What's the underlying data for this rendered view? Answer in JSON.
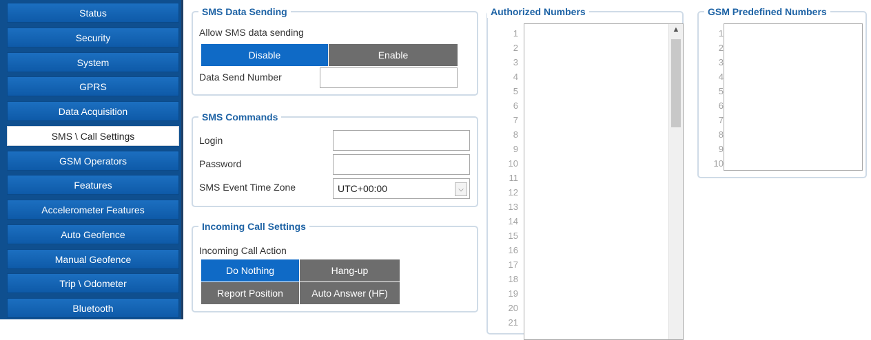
{
  "sidebar": {
    "items": [
      {
        "label": "Status",
        "active": false
      },
      {
        "label": "Security",
        "active": false
      },
      {
        "label": "System",
        "active": false
      },
      {
        "label": "GPRS",
        "active": false
      },
      {
        "label": "Data Acquisition",
        "active": false
      },
      {
        "label": "SMS \\ Call Settings",
        "active": true
      },
      {
        "label": "GSM Operators",
        "active": false
      },
      {
        "label": "Features",
        "active": false
      },
      {
        "label": "Accelerometer Features",
        "active": false
      },
      {
        "label": "Auto Geofence",
        "active": false
      },
      {
        "label": "Manual Geofence",
        "active": false
      },
      {
        "label": "Trip \\ Odometer",
        "active": false
      },
      {
        "label": "Bluetooth",
        "active": false
      }
    ]
  },
  "sms_data_sending": {
    "title": "SMS Data Sending",
    "allow_label": "Allow SMS data sending",
    "options": [
      "Disable",
      "Enable"
    ],
    "selected": "Disable",
    "number_label": "Data Send Number",
    "number_value": ""
  },
  "sms_commands": {
    "title": "SMS Commands",
    "login_label": "Login",
    "login_value": "",
    "password_label": "Password",
    "password_value": "",
    "timezone_label": "SMS Event Time Zone",
    "timezone_value": "UTC+00:00"
  },
  "incoming_call": {
    "title": "Incoming Call Settings",
    "action_label": "Incoming Call Action",
    "options": [
      "Do Nothing",
      "Hang-up",
      "Report Position",
      "Auto Answer (HF)"
    ],
    "selected": "Do Nothing"
  },
  "authorized_numbers": {
    "title": "Authorized Numbers",
    "line_numbers": [
      "1",
      "2",
      "3",
      "4",
      "5",
      "6",
      "7",
      "8",
      "9",
      "10",
      "11",
      "12",
      "13",
      "14",
      "15",
      "16",
      "17",
      "18",
      "19",
      "20",
      "21"
    ]
  },
  "gsm_predefined": {
    "title": "GSM Predefined Numbers",
    "line_numbers": [
      "1",
      "2",
      "3",
      "4",
      "5",
      "6",
      "7",
      "8",
      "9",
      "10"
    ]
  },
  "colors": {
    "sidebar_bg": "#0f4f8f",
    "accent_blue": "#0f6ac6",
    "inactive_gray": "#6d6d6d",
    "title_blue": "#1e63a5"
  }
}
